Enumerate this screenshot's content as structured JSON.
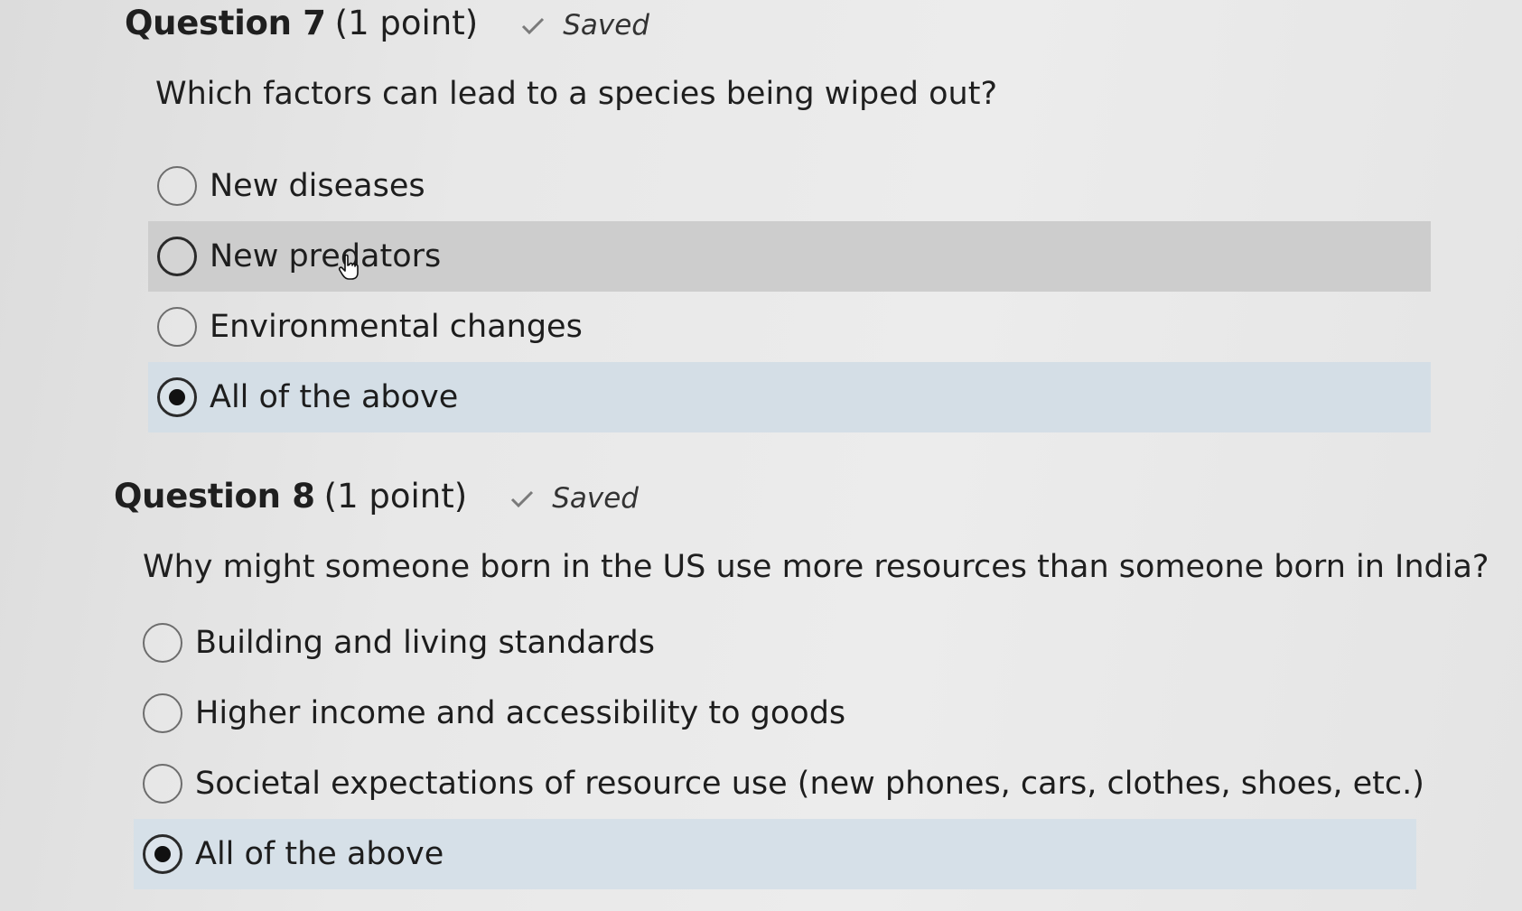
{
  "questions": [
    {
      "title": "Question 7",
      "points": "(1 point)",
      "status": "Saved",
      "text": "Which factors can lead to a species being wiped out?",
      "options": [
        {
          "label": "New diseases",
          "selected": false
        },
        {
          "label": "New predators",
          "selected": false
        },
        {
          "label": "Environmental changes",
          "selected": false
        },
        {
          "label": "All of the above",
          "selected": true
        }
      ]
    },
    {
      "title": "Question 8",
      "points": "(1 point)",
      "status": "Saved",
      "text": "Why might someone born in the US use more resources than someone born in India?",
      "options": [
        {
          "label": "Building and living standards",
          "selected": false
        },
        {
          "label": "Higher income and accessibility to goods",
          "selected": false
        },
        {
          "label": "Societal expectations of resource use (new phones, cars, clothes, shoes, etc.)",
          "selected": false
        },
        {
          "label": "All of the above",
          "selected": true
        }
      ]
    }
  ],
  "colors": {
    "hover_row": "#cdcdcd",
    "selected_row": "#d4dee6",
    "check": "#7a7a7a"
  },
  "icons": {
    "saved": "check-icon",
    "pointer": "hand-cursor-icon"
  }
}
